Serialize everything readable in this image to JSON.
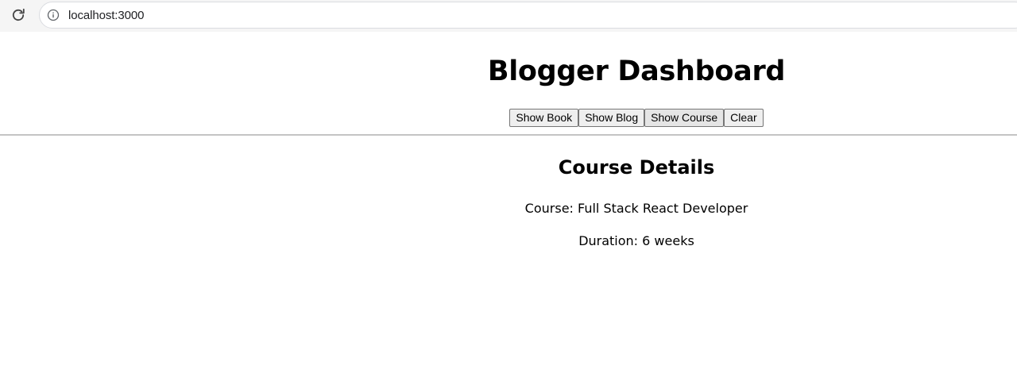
{
  "browser": {
    "url": "localhost:3000"
  },
  "header": {
    "title": "Blogger Dashboard"
  },
  "toolbar": {
    "show_book_label": "Show Book",
    "show_blog_label": "Show Blog",
    "show_course_label": "Show Course",
    "clear_label": "Clear"
  },
  "main": {
    "section_title": "Course Details",
    "course_line": "Course: Full Stack React Developer",
    "duration_line": "Duration: 6 weeks"
  },
  "icons": {
    "reload": "reload-icon",
    "info": "info-icon"
  }
}
